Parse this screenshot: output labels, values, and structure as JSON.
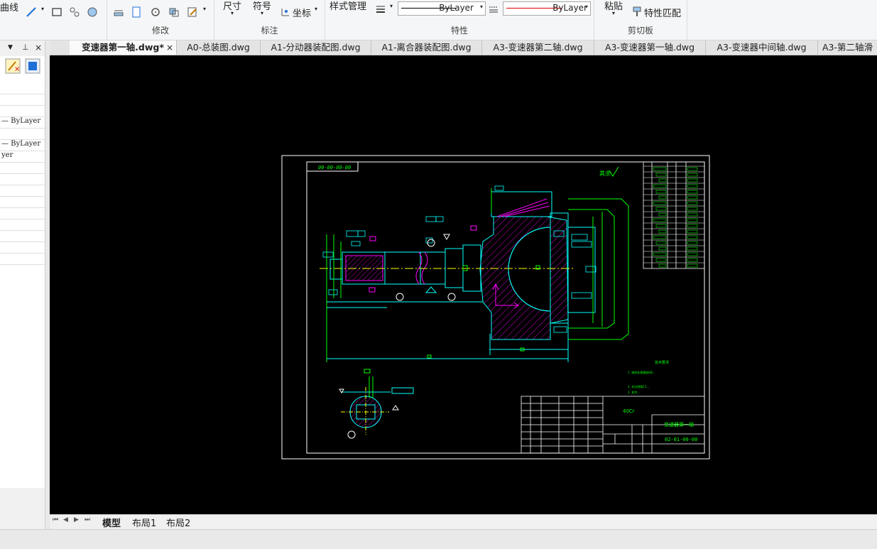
{
  "ribbon": {
    "curve_label": "曲线",
    "modify_panel": "修改",
    "annotate": {
      "panel": "标注",
      "dimension": "尺寸",
      "symbol": "符号",
      "coordinate": "坐标"
    },
    "properties": {
      "panel": "特性",
      "style_manager": "样式管理",
      "linetype_value": "ByLayer",
      "color_value": "ByLayer"
    },
    "clipboard": {
      "panel": "剪切板",
      "paste": "粘贴",
      "match_properties": "特性匹配"
    }
  },
  "tabs": [
    {
      "label": "变速器第一轴.dwg*",
      "active": true,
      "close": "×"
    },
    {
      "label": "A0-总装图.dwg"
    },
    {
      "label": "A1-分动器装配图.dwg"
    },
    {
      "label": "A1-离合器装配图.dwg"
    },
    {
      "label": "A3-变速器第二轴.dwg"
    },
    {
      "label": "A3-变速器第一轴.dwg"
    },
    {
      "label": "A3-变速器中间轴.dwg"
    },
    {
      "label": "A3-第二轴滑"
    }
  ],
  "left_panel": {
    "header_icons": [
      "chevron-down-icon",
      "pin-icon",
      "close-icon"
    ],
    "rows": [
      "",
      "",
      "",
      "— ByLayer",
      "",
      "— ByLayer",
      "yer",
      "",
      "",
      "",
      "",
      "",
      "",
      "",
      "",
      ""
    ]
  },
  "drawing": {
    "drawing_number_box": "00-00-00-00",
    "roughness_note": "其余",
    "material": "40Cr",
    "part_name": "变速器第一轴",
    "part_number": "02-01-00-00",
    "tech_requirements_title": "技术要求",
    "tech_requirements": [
      "1. 调质处理硬度HB...",
      "2. 未注倒角C1...",
      "3. 其余..."
    ],
    "colors": {
      "frame": "#ffffff",
      "outline": "#00ffff",
      "dim": "#00ff00",
      "hatch": "#ff00ff",
      "center": "#ffff00",
      "text": "#00ff00"
    }
  },
  "layout_tabs": {
    "model": "模型",
    "layout1": "布局1",
    "layout2": "布局2"
  }
}
